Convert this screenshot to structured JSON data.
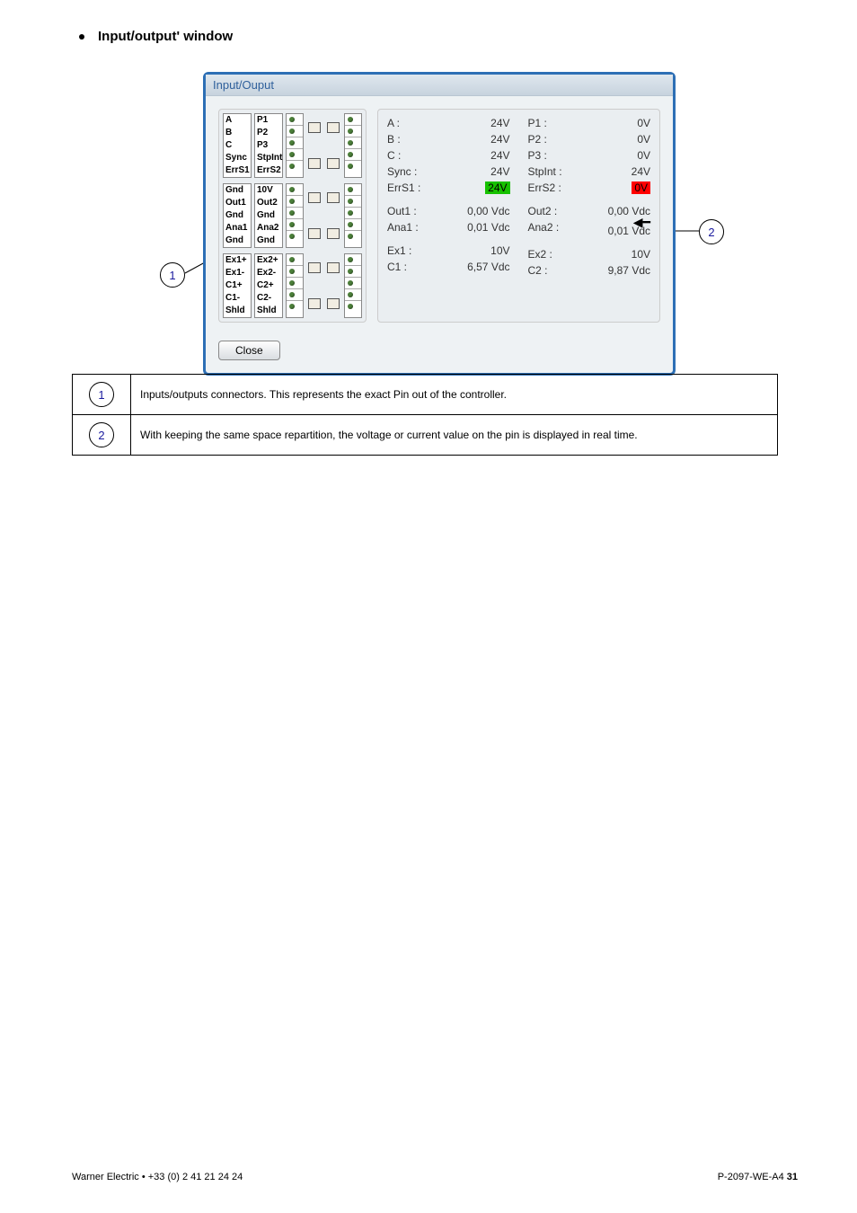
{
  "heading": "Input/output' window",
  "window_title": "Input/Ouput",
  "connectors": {
    "block1": {
      "left": [
        "A",
        "B",
        "C",
        "Sync",
        "ErrS1"
      ],
      "right": [
        "P1",
        "P2",
        "P3",
        "StpInt",
        "ErrS2"
      ]
    },
    "block2": {
      "left": [
        "Gnd",
        "Out1",
        "Gnd",
        "Ana1",
        "Gnd"
      ],
      "right": [
        "10V",
        "Out2",
        "Gnd",
        "Ana2",
        "Gnd"
      ]
    },
    "block3": {
      "left": [
        "Ex1+",
        "Ex1-",
        "C1+",
        "C1-",
        "Shld"
      ],
      "right": [
        "Ex2+",
        "Ex2-",
        "C2+",
        "C2-",
        "Shld"
      ]
    }
  },
  "status": {
    "left_col": {
      "group1": [
        {
          "label": "A :",
          "value": "24V"
        },
        {
          "label": "B :",
          "value": "24V"
        },
        {
          "label": "C :",
          "value": "24V"
        },
        {
          "label": "Sync :",
          "value": "24V"
        },
        {
          "label": "ErrS1 :",
          "value": "24V",
          "hl": "green"
        }
      ],
      "group2": [
        {
          "label": "Out1 :",
          "value": "0,00 Vdc"
        },
        {
          "label": "Ana1 :",
          "value": "0,01 Vdc"
        }
      ],
      "group3": [
        {
          "label": "Ex1 :",
          "value": "10V"
        },
        {
          "label": "C1 :",
          "value": "6,57 Vdc"
        }
      ]
    },
    "right_col": {
      "group1": [
        {
          "label": "P1 :",
          "value": "0V"
        },
        {
          "label": "P2 :",
          "value": "0V"
        },
        {
          "label": "P3 :",
          "value": "0V"
        },
        {
          "label": "StpInt :",
          "value": "24V"
        },
        {
          "label": "ErrS2 :",
          "value": "0V",
          "hl": "red"
        }
      ],
      "group2": [
        {
          "label": "Out2 :",
          "value": "0,00 Vdc"
        },
        {
          "label": "Ana2 :",
          "value": "0,01 Vdc",
          "arrow": true
        }
      ],
      "group3": [
        {
          "label": "Ex2 :",
          "value": "10V"
        },
        {
          "label": "C2 :",
          "value": "9,87 Vdc"
        }
      ]
    }
  },
  "close_label": "Close",
  "callouts": {
    "c1": "1",
    "c2": "2"
  },
  "legend": {
    "row1": "Inputs/outputs connectors. This represents the exact Pin out of the controller.",
    "row2": "With keeping the same space repartition, the voltage or current value on the pin is displayed in real time."
  },
  "footer": {
    "left": "Warner Electric • +33 (0) 2 41 21 24 24",
    "right_prefix": "P-2097-WE-A4  ",
    "right_page": "31"
  }
}
